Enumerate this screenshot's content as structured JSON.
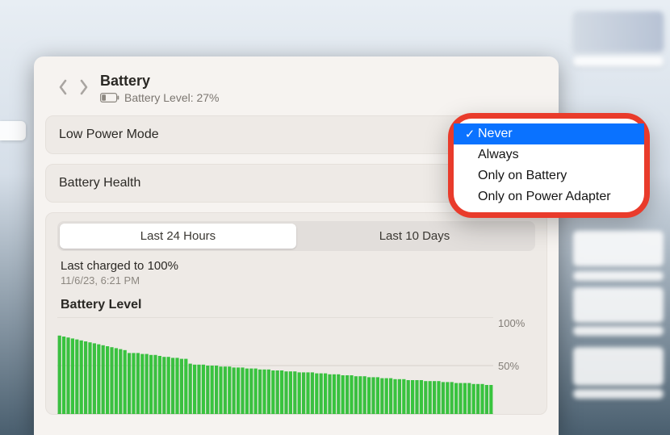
{
  "header": {
    "title": "Battery",
    "subtitle": "Battery Level: 27%"
  },
  "rows": {
    "low_power_mode": "Low Power Mode",
    "battery_health": "Battery Health"
  },
  "segmented": {
    "items": [
      "Last 24 Hours",
      "Last 10 Days"
    ],
    "selected_index": 0
  },
  "last_charged": {
    "label": "Last charged to 100%",
    "timestamp": "11/6/23, 6:21 PM"
  },
  "chart_title": "Battery Level",
  "yticks": [
    "100%",
    "50%",
    ""
  ],
  "dropdown": {
    "items": [
      "Never",
      "Always",
      "Only on Battery",
      "Only on Power Adapter"
    ],
    "selected_index": 0
  },
  "chart_data": {
    "type": "bar",
    "title": "Battery Level",
    "ylabel": "",
    "xlabel": "",
    "ylim": [
      0,
      100
    ],
    "yticks": [
      50,
      100
    ],
    "values": [
      81,
      80,
      79,
      78,
      77,
      76,
      75,
      74,
      73,
      72,
      71,
      70,
      69,
      68,
      67,
      66,
      63,
      63,
      63,
      62,
      62,
      61,
      61,
      60,
      59,
      59,
      58,
      58,
      57,
      57,
      52,
      51,
      51,
      51,
      50,
      50,
      50,
      49,
      49,
      49,
      48,
      48,
      48,
      47,
      47,
      47,
      46,
      46,
      46,
      45,
      45,
      45,
      44,
      44,
      44,
      43,
      43,
      43,
      43,
      42,
      42,
      42,
      41,
      41,
      41,
      40,
      40,
      40,
      39,
      39,
      39,
      38,
      38,
      38,
      37,
      37,
      37,
      36,
      36,
      36,
      35,
      35,
      35,
      35,
      34,
      34,
      34,
      34,
      33,
      33,
      33,
      32,
      32,
      32,
      32,
      31,
      31,
      31,
      30,
      30
    ]
  }
}
